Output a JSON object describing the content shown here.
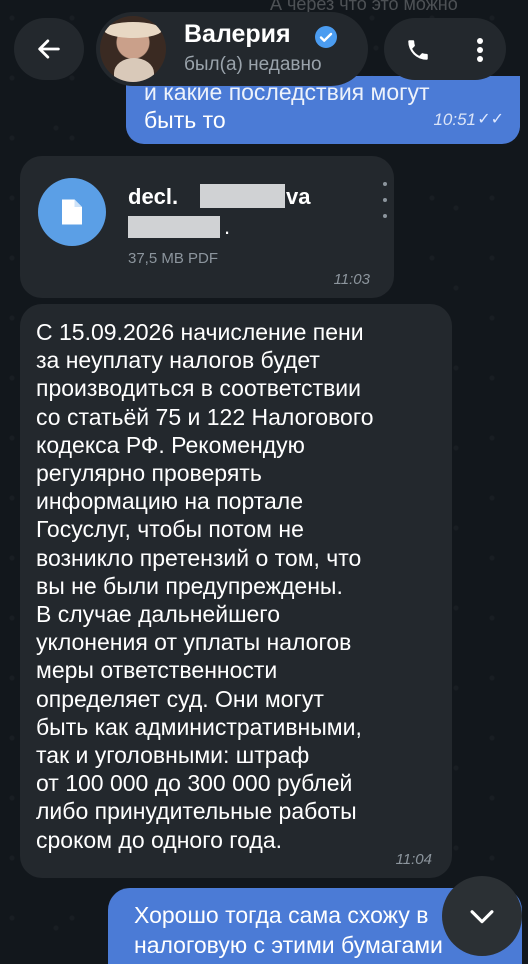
{
  "header": {
    "faded_text": "А через что это можно",
    "contact_name": "Валерия",
    "status": "был(а) недавно"
  },
  "icons": {
    "back": "arrow-left-icon",
    "verified": "verified-badge-icon",
    "call": "phone-icon",
    "menu": "more-vertical-icon",
    "file": "document-icon",
    "scroll": "chevron-down-icon"
  },
  "colors": {
    "background": "#12171c",
    "incoming_bubble": "#23282d",
    "outgoing_bubble": "#4b7bd6",
    "file_icon": "#5b9fe6",
    "verified": "#4b9cf0"
  },
  "messages": {
    "top_outgoing": {
      "line1": "и какие последствия могут",
      "line2": "быть то",
      "time": "10:51",
      "ticks": "✓✓"
    },
    "file": {
      "name_start": "decl.",
      "name_end": "va",
      "name_dot": ".",
      "meta": "37,5 MB PDF",
      "time": "11:03"
    },
    "long_incoming": {
      "text": "С 15.09.2026 начисление пени\nза неуплату налогов будет\nпроизводиться в соответствии\nсо статьёй 75 и 122 Налогового\nкодекса РФ. Рекомендую\nрегулярно проверять\nинформацию на портале\nГосуслуг, чтобы потом не\nвозникло претензий о том, что\nвы не были предупреждены.\nВ случае дальнейшего\nуклонения от уплаты налогов\nмеры ответственности\nопределяет суд. Они могут\nбыть как административными,\nтак и уголовными: штраф\nот 100 000 до 300 000 рублей\nлибо принудительные работы\nсроком до одного года.",
      "time": "11:04"
    },
    "bottom_outgoing": {
      "text": "Хорошо тогда сама схожу в\nналоговую с этими бумагами"
    }
  }
}
